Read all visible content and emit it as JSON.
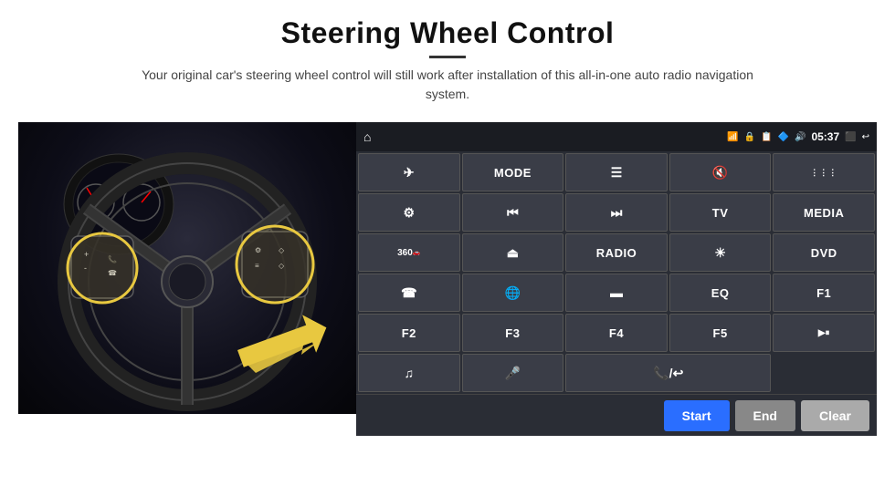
{
  "header": {
    "title": "Steering Wheel Control",
    "subtitle": "Your original car's steering wheel control will still work after installation of this all-in-one auto radio navigation system."
  },
  "status_bar": {
    "time": "05:37",
    "icons": [
      "wifi",
      "lock",
      "sim",
      "bluetooth",
      "volume",
      "screen",
      "back"
    ]
  },
  "control_buttons": [
    {
      "id": "home",
      "icon": "⌂",
      "text": "",
      "type": "icon"
    },
    {
      "id": "nav",
      "icon": "✈",
      "text": "",
      "type": "icon"
    },
    {
      "id": "mode",
      "icon": "",
      "text": "MODE",
      "type": "text"
    },
    {
      "id": "list",
      "icon": "☰",
      "text": "",
      "type": "icon"
    },
    {
      "id": "mute",
      "icon": "🔇",
      "text": "",
      "type": "icon"
    },
    {
      "id": "apps",
      "icon": "⋮⋮⋮",
      "text": "",
      "type": "icon"
    },
    {
      "id": "settings",
      "icon": "⚙",
      "text": "",
      "type": "icon"
    },
    {
      "id": "prev",
      "icon": "⏮",
      "text": "",
      "type": "icon"
    },
    {
      "id": "next",
      "icon": "⏭",
      "text": "",
      "type": "icon"
    },
    {
      "id": "tv",
      "icon": "",
      "text": "TV",
      "type": "text"
    },
    {
      "id": "media",
      "icon": "",
      "text": "MEDIA",
      "type": "text"
    },
    {
      "id": "360cam",
      "icon": "360",
      "text": "",
      "type": "icon"
    },
    {
      "id": "eject",
      "icon": "⏏",
      "text": "",
      "type": "icon"
    },
    {
      "id": "radio",
      "icon": "",
      "text": "RADIO",
      "type": "text"
    },
    {
      "id": "bright",
      "icon": "☀",
      "text": "",
      "type": "icon"
    },
    {
      "id": "dvd",
      "icon": "",
      "text": "DVD",
      "type": "text"
    },
    {
      "id": "phone",
      "icon": "☎",
      "text": "",
      "type": "icon"
    },
    {
      "id": "browser",
      "icon": "🌐",
      "text": "",
      "type": "icon"
    },
    {
      "id": "screen2",
      "icon": "▬",
      "text": "",
      "type": "icon"
    },
    {
      "id": "eq",
      "icon": "",
      "text": "EQ",
      "type": "text"
    },
    {
      "id": "f1",
      "icon": "",
      "text": "F1",
      "type": "text"
    },
    {
      "id": "f2",
      "icon": "",
      "text": "F2",
      "type": "text"
    },
    {
      "id": "f3",
      "icon": "",
      "text": "F3",
      "type": "text"
    },
    {
      "id": "f4",
      "icon": "",
      "text": "F4",
      "type": "text"
    },
    {
      "id": "f5",
      "icon": "",
      "text": "F5",
      "type": "text"
    },
    {
      "id": "playpause",
      "icon": "▶⏸",
      "text": "",
      "type": "icon"
    },
    {
      "id": "music",
      "icon": "♫",
      "text": "",
      "type": "icon"
    },
    {
      "id": "mic",
      "icon": "🎤",
      "text": "",
      "type": "icon"
    },
    {
      "id": "call",
      "icon": "📞",
      "text": "",
      "type": "icon"
    }
  ],
  "bottom_bar": {
    "start_label": "Start",
    "end_label": "End",
    "clear_label": "Clear"
  }
}
